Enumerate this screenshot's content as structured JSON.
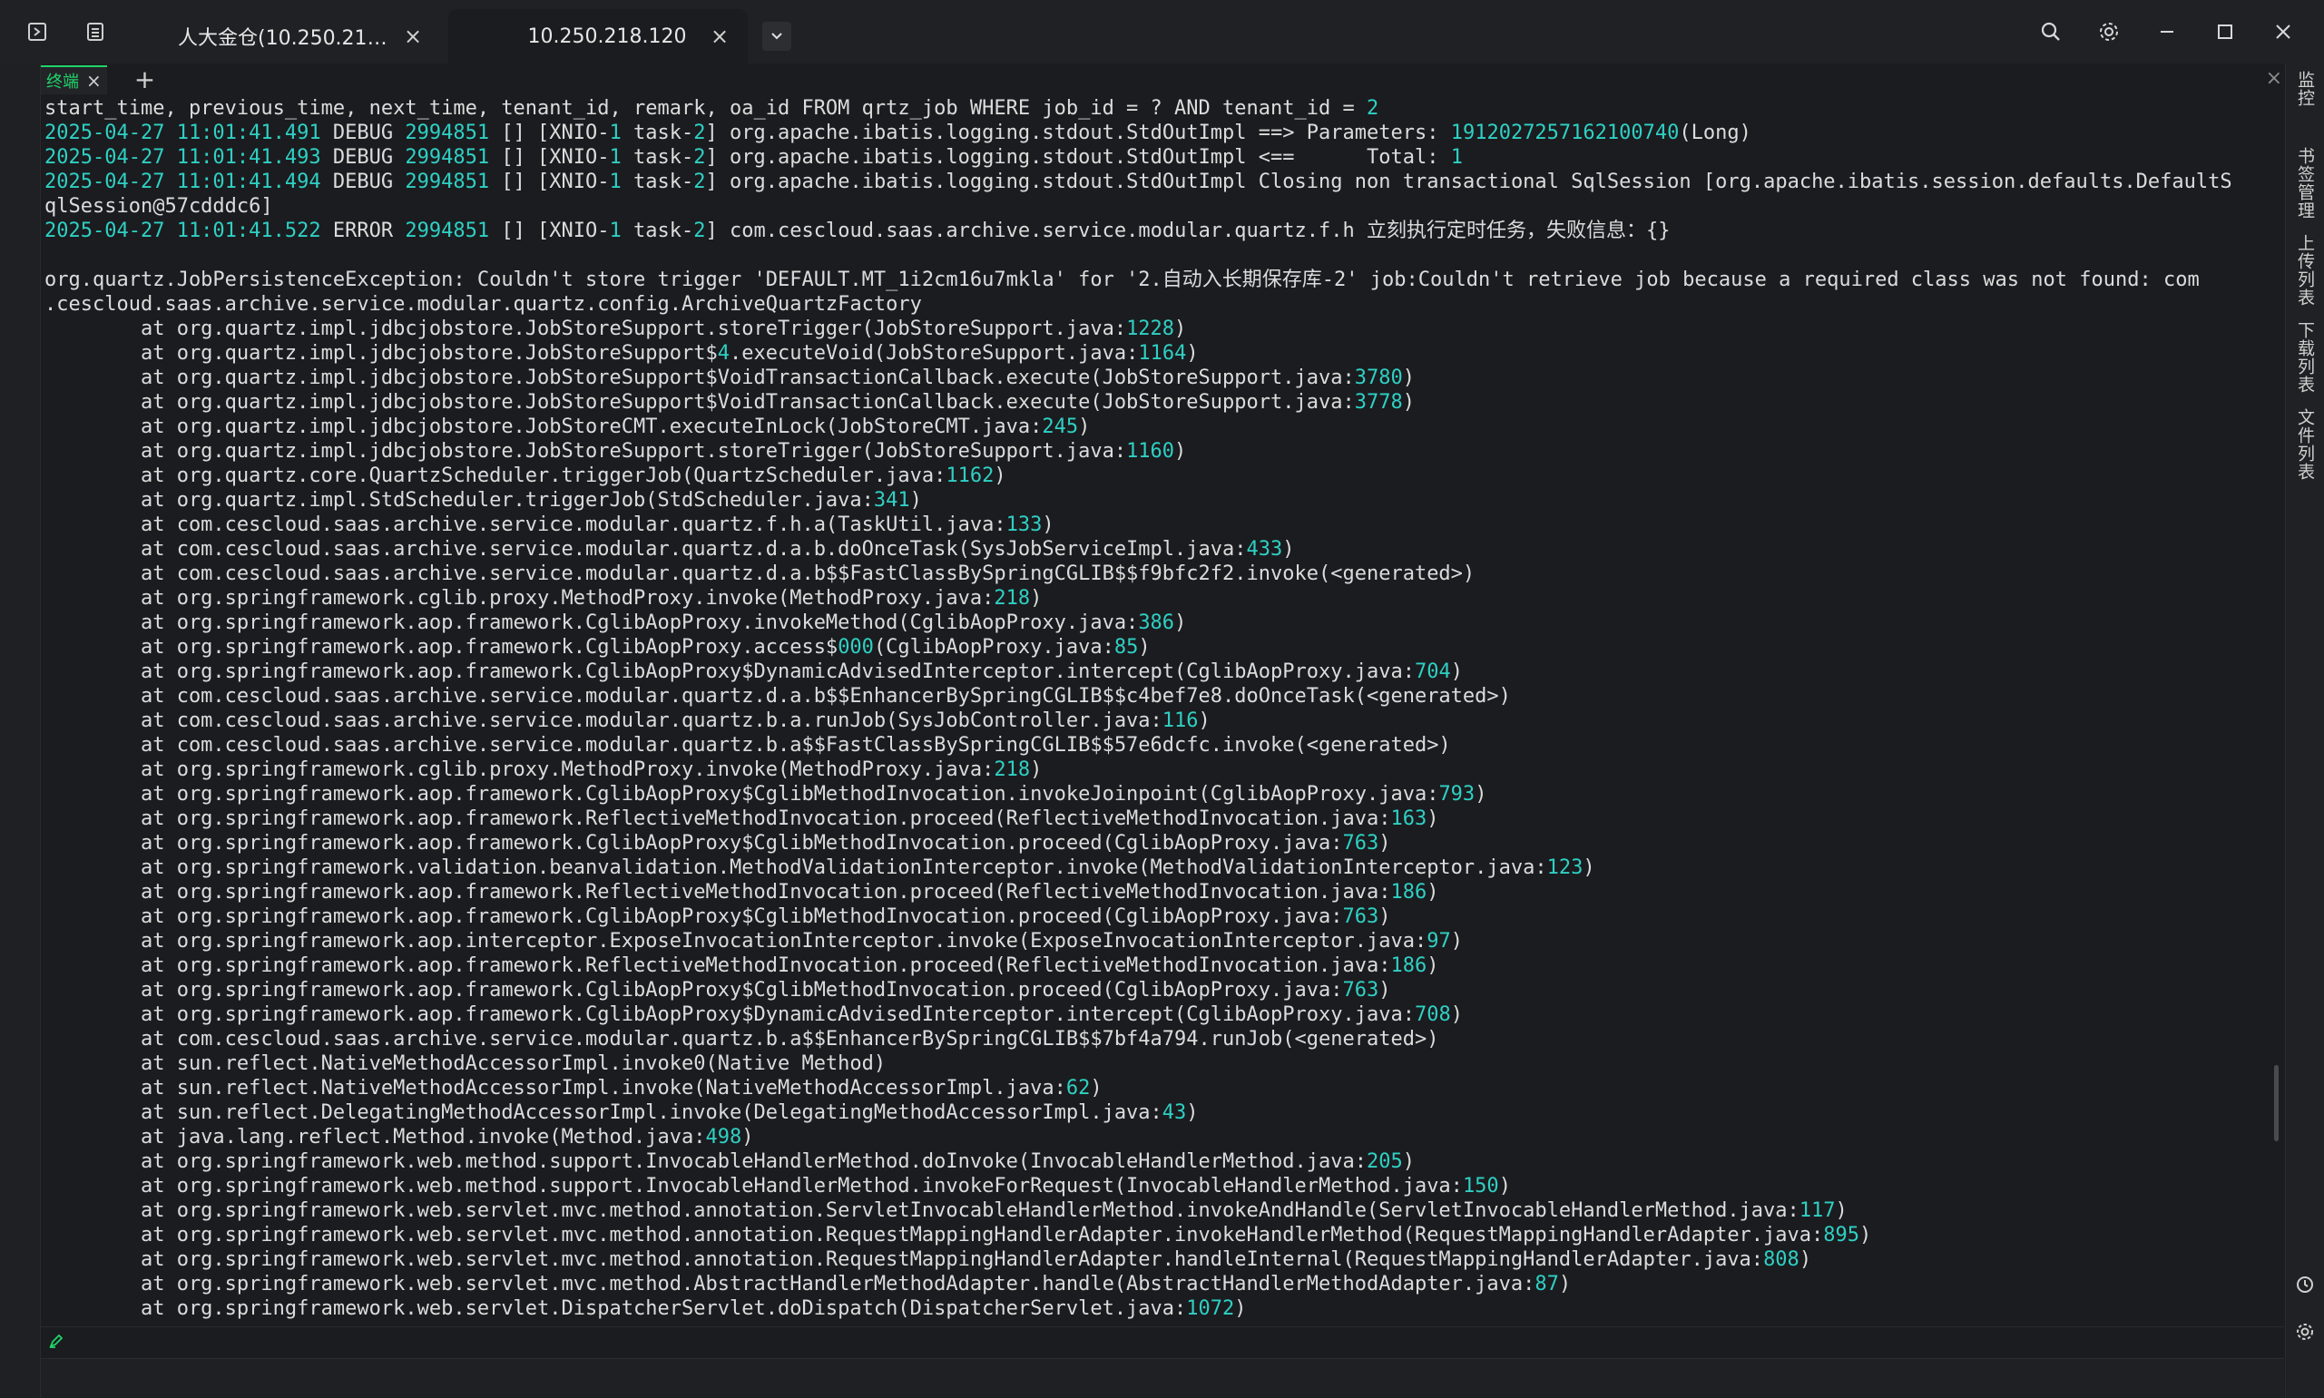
{
  "titlebar": {
    "tabs": [
      {
        "label": "人大金仓(10.250.218.2...",
        "active": false
      },
      {
        "label": "10.250.218.120",
        "active": true
      }
    ],
    "left_icons": [
      "sidebar-toggle-icon",
      "session-list-icon"
    ],
    "right_icons": [
      "search-icon",
      "settings-icon",
      "minimize-icon",
      "maximize-icon",
      "close-icon"
    ]
  },
  "subtabs": {
    "items": [
      {
        "label": "终端"
      }
    ],
    "add_label": "+"
  },
  "right_panel": {
    "tabs": [
      {
        "label": "监控"
      },
      {
        "label": "书签管理"
      },
      {
        "label": "上传列表"
      },
      {
        "label": "下载列表"
      },
      {
        "label": "文件列表"
      }
    ],
    "bottom_icons": [
      "history-icon",
      "gear-icon"
    ]
  },
  "colors": {
    "accent": "#20d46a",
    "log_highlight": "#2fd0c4",
    "background": "#1b1c1f"
  },
  "terminal": {
    "lines": [
      [
        {
          "t": "start_time, previous_time, next_time, tenant_id, remark, oa_id FROM qrtz_job WHERE job_id = ? AND tenant_id = ",
          "c": "w"
        },
        {
          "t": "2",
          "c": "c"
        }
      ],
      [
        {
          "t": "2025-04-27 11:01:41.491",
          "c": "c"
        },
        {
          "t": " DEBUG ",
          "c": "w"
        },
        {
          "t": "2994851",
          "c": "c"
        },
        {
          "t": " [] [XNIO-",
          "c": "w"
        },
        {
          "t": "1",
          "c": "c"
        },
        {
          "t": " task-",
          "c": "w"
        },
        {
          "t": "2",
          "c": "c"
        },
        {
          "t": "] org.apache.ibatis.logging.stdout.StdOutImpl ==> Parameters: ",
          "c": "w"
        },
        {
          "t": "1912027257162100740",
          "c": "c"
        },
        {
          "t": "(Long)",
          "c": "w"
        }
      ],
      [
        {
          "t": "2025-04-27 11:01:41.493",
          "c": "c"
        },
        {
          "t": " DEBUG ",
          "c": "w"
        },
        {
          "t": "2994851",
          "c": "c"
        },
        {
          "t": " [] [XNIO-",
          "c": "w"
        },
        {
          "t": "1",
          "c": "c"
        },
        {
          "t": " task-",
          "c": "w"
        },
        {
          "t": "2",
          "c": "c"
        },
        {
          "t": "] org.apache.ibatis.logging.stdout.StdOutImpl <==      Total: ",
          "c": "w"
        },
        {
          "t": "1",
          "c": "c"
        }
      ],
      [
        {
          "t": "2025-04-27 11:01:41.494",
          "c": "c"
        },
        {
          "t": " DEBUG ",
          "c": "w"
        },
        {
          "t": "2994851",
          "c": "c"
        },
        {
          "t": " [] [XNIO-",
          "c": "w"
        },
        {
          "t": "1",
          "c": "c"
        },
        {
          "t": " task-",
          "c": "w"
        },
        {
          "t": "2",
          "c": "c"
        },
        {
          "t": "] org.apache.ibatis.logging.stdout.StdOutImpl Closing non transactional SqlSession [org.apache.ibatis.session.defaults.DefaultS",
          "c": "w"
        }
      ],
      [
        {
          "t": "qlSession@57cdddc6]",
          "c": "w"
        }
      ],
      [
        {
          "t": "2025-04-27 11:01:41.522",
          "c": "c"
        },
        {
          "t": " ERROR ",
          "c": "w"
        },
        {
          "t": "2994851",
          "c": "c"
        },
        {
          "t": " [] [XNIO-",
          "c": "w"
        },
        {
          "t": "1",
          "c": "c"
        },
        {
          "t": " task-",
          "c": "w"
        },
        {
          "t": "2",
          "c": "c"
        },
        {
          "t": "] com.cescloud.saas.archive.service.modular.quartz.f.h 立刻执行定时任务，失败信息：{}",
          "c": "w"
        }
      ],
      [
        {
          "t": " ",
          "c": "w"
        }
      ],
      [
        {
          "t": "org.quartz.JobPersistenceException: Couldn't store trigger 'DEFAULT.MT_1i2cm16u7mkla' for '2.自动入长期保存库-2' job:Couldn't retrieve job because a required class was not found: com",
          "c": "w"
        }
      ],
      [
        {
          "t": ".cescloud.saas.archive.service.modular.quartz.config.ArchiveQuartzFactory",
          "c": "w"
        }
      ],
      [
        {
          "t": "        at org.quartz.impl.jdbcjobstore.JobStoreSupport.storeTrigger(JobStoreSupport.java:",
          "c": "w"
        },
        {
          "t": "1228",
          "c": "c"
        },
        {
          "t": ")",
          "c": "w"
        }
      ],
      [
        {
          "t": "        at org.quartz.impl.jdbcjobstore.JobStoreSupport$",
          "c": "w"
        },
        {
          "t": "4",
          "c": "c"
        },
        {
          "t": ".executeVoid(JobStoreSupport.java:",
          "c": "w"
        },
        {
          "t": "1164",
          "c": "c"
        },
        {
          "t": ")",
          "c": "w"
        }
      ],
      [
        {
          "t": "        at org.quartz.impl.jdbcjobstore.JobStoreSupport$VoidTransactionCallback.execute(JobStoreSupport.java:",
          "c": "w"
        },
        {
          "t": "3780",
          "c": "c"
        },
        {
          "t": ")",
          "c": "w"
        }
      ],
      [
        {
          "t": "        at org.quartz.impl.jdbcjobstore.JobStoreSupport$VoidTransactionCallback.execute(JobStoreSupport.java:",
          "c": "w"
        },
        {
          "t": "3778",
          "c": "c"
        },
        {
          "t": ")",
          "c": "w"
        }
      ],
      [
        {
          "t": "        at org.quartz.impl.jdbcjobstore.JobStoreCMT.executeInLock(JobStoreCMT.java:",
          "c": "w"
        },
        {
          "t": "245",
          "c": "c"
        },
        {
          "t": ")",
          "c": "w"
        }
      ],
      [
        {
          "t": "        at org.quartz.impl.jdbcjobstore.JobStoreSupport.storeTrigger(JobStoreSupport.java:",
          "c": "w"
        },
        {
          "t": "1160",
          "c": "c"
        },
        {
          "t": ")",
          "c": "w"
        }
      ],
      [
        {
          "t": "        at org.quartz.core.QuartzScheduler.triggerJob(QuartzScheduler.java:",
          "c": "w"
        },
        {
          "t": "1162",
          "c": "c"
        },
        {
          "t": ")",
          "c": "w"
        }
      ],
      [
        {
          "t": "        at org.quartz.impl.StdScheduler.triggerJob(StdScheduler.java:",
          "c": "w"
        },
        {
          "t": "341",
          "c": "c"
        },
        {
          "t": ")",
          "c": "w"
        }
      ],
      [
        {
          "t": "        at com.cescloud.saas.archive.service.modular.quartz.f.h.a(TaskUtil.java:",
          "c": "w"
        },
        {
          "t": "133",
          "c": "c"
        },
        {
          "t": ")",
          "c": "w"
        }
      ],
      [
        {
          "t": "        at com.cescloud.saas.archive.service.modular.quartz.d.a.b.doOnceTask(SysJobServiceImpl.java:",
          "c": "w"
        },
        {
          "t": "433",
          "c": "c"
        },
        {
          "t": ")",
          "c": "w"
        }
      ],
      [
        {
          "t": "        at com.cescloud.saas.archive.service.modular.quartz.d.a.b$$FastClassBySpringCGLIB$$f9bfc2f2.invoke(<generated>)",
          "c": "w"
        }
      ],
      [
        {
          "t": "        at org.springframework.cglib.proxy.MethodProxy.invoke(MethodProxy.java:",
          "c": "w"
        },
        {
          "t": "218",
          "c": "c"
        },
        {
          "t": ")",
          "c": "w"
        }
      ],
      [
        {
          "t": "        at org.springframework.aop.framework.CglibAopProxy.invokeMethod(CglibAopProxy.java:",
          "c": "w"
        },
        {
          "t": "386",
          "c": "c"
        },
        {
          "t": ")",
          "c": "w"
        }
      ],
      [
        {
          "t": "        at org.springframework.aop.framework.CglibAopProxy.access$",
          "c": "w"
        },
        {
          "t": "000",
          "c": "c"
        },
        {
          "t": "(CglibAopProxy.java:",
          "c": "w"
        },
        {
          "t": "85",
          "c": "c"
        },
        {
          "t": ")",
          "c": "w"
        }
      ],
      [
        {
          "t": "        at org.springframework.aop.framework.CglibAopProxy$DynamicAdvisedInterceptor.intercept(CglibAopProxy.java:",
          "c": "w"
        },
        {
          "t": "704",
          "c": "c"
        },
        {
          "t": ")",
          "c": "w"
        }
      ],
      [
        {
          "t": "        at com.cescloud.saas.archive.service.modular.quartz.d.a.b$$EnhancerBySpringCGLIB$$c4bef7e8.doOnceTask(<generated>)",
          "c": "w"
        }
      ],
      [
        {
          "t": "        at com.cescloud.saas.archive.service.modular.quartz.b.a.runJob(SysJobController.java:",
          "c": "w"
        },
        {
          "t": "116",
          "c": "c"
        },
        {
          "t": ")",
          "c": "w"
        }
      ],
      [
        {
          "t": "        at com.cescloud.saas.archive.service.modular.quartz.b.a$$FastClassBySpringCGLIB$$57e6dcfc.invoke(<generated>)",
          "c": "w"
        }
      ],
      [
        {
          "t": "        at org.springframework.cglib.proxy.MethodProxy.invoke(MethodProxy.java:",
          "c": "w"
        },
        {
          "t": "218",
          "c": "c"
        },
        {
          "t": ")",
          "c": "w"
        }
      ],
      [
        {
          "t": "        at org.springframework.aop.framework.CglibAopProxy$CglibMethodInvocation.invokeJoinpoint(CglibAopProxy.java:",
          "c": "w"
        },
        {
          "t": "793",
          "c": "c"
        },
        {
          "t": ")",
          "c": "w"
        }
      ],
      [
        {
          "t": "        at org.springframework.aop.framework.ReflectiveMethodInvocation.proceed(ReflectiveMethodInvocation.java:",
          "c": "w"
        },
        {
          "t": "163",
          "c": "c"
        },
        {
          "t": ")",
          "c": "w"
        }
      ],
      [
        {
          "t": "        at org.springframework.aop.framework.CglibAopProxy$CglibMethodInvocation.proceed(CglibAopProxy.java:",
          "c": "w"
        },
        {
          "t": "763",
          "c": "c"
        },
        {
          "t": ")",
          "c": "w"
        }
      ],
      [
        {
          "t": "        at org.springframework.validation.beanvalidation.MethodValidationInterceptor.invoke(MethodValidationInterceptor.java:",
          "c": "w"
        },
        {
          "t": "123",
          "c": "c"
        },
        {
          "t": ")",
          "c": "w"
        }
      ],
      [
        {
          "t": "        at org.springframework.aop.framework.ReflectiveMethodInvocation.proceed(ReflectiveMethodInvocation.java:",
          "c": "w"
        },
        {
          "t": "186",
          "c": "c"
        },
        {
          "t": ")",
          "c": "w"
        }
      ],
      [
        {
          "t": "        at org.springframework.aop.framework.CglibAopProxy$CglibMethodInvocation.proceed(CglibAopProxy.java:",
          "c": "w"
        },
        {
          "t": "763",
          "c": "c"
        },
        {
          "t": ")",
          "c": "w"
        }
      ],
      [
        {
          "t": "        at org.springframework.aop.interceptor.ExposeInvocationInterceptor.invoke(ExposeInvocationInterceptor.java:",
          "c": "w"
        },
        {
          "t": "97",
          "c": "c"
        },
        {
          "t": ")",
          "c": "w"
        }
      ],
      [
        {
          "t": "        at org.springframework.aop.framework.ReflectiveMethodInvocation.proceed(ReflectiveMethodInvocation.java:",
          "c": "w"
        },
        {
          "t": "186",
          "c": "c"
        },
        {
          "t": ")",
          "c": "w"
        }
      ],
      [
        {
          "t": "        at org.springframework.aop.framework.CglibAopProxy$CglibMethodInvocation.proceed(CglibAopProxy.java:",
          "c": "w"
        },
        {
          "t": "763",
          "c": "c"
        },
        {
          "t": ")",
          "c": "w"
        }
      ],
      [
        {
          "t": "        at org.springframework.aop.framework.CglibAopProxy$DynamicAdvisedInterceptor.intercept(CglibAopProxy.java:",
          "c": "w"
        },
        {
          "t": "708",
          "c": "c"
        },
        {
          "t": ")",
          "c": "w"
        }
      ],
      [
        {
          "t": "        at com.cescloud.saas.archive.service.modular.quartz.b.a$$EnhancerBySpringCGLIB$$7bf4a794.runJob(<generated>)",
          "c": "w"
        }
      ],
      [
        {
          "t": "        at sun.reflect.NativeMethodAccessorImpl.invoke0(Native Method)",
          "c": "w"
        }
      ],
      [
        {
          "t": "        at sun.reflect.NativeMethodAccessorImpl.invoke(NativeMethodAccessorImpl.java:",
          "c": "w"
        },
        {
          "t": "62",
          "c": "c"
        },
        {
          "t": ")",
          "c": "w"
        }
      ],
      [
        {
          "t": "        at sun.reflect.DelegatingMethodAccessorImpl.invoke(DelegatingMethodAccessorImpl.java:",
          "c": "w"
        },
        {
          "t": "43",
          "c": "c"
        },
        {
          "t": ")",
          "c": "w"
        }
      ],
      [
        {
          "t": "        at java.lang.reflect.Method.invoke(Method.java:",
          "c": "w"
        },
        {
          "t": "498",
          "c": "c"
        },
        {
          "t": ")",
          "c": "w"
        }
      ],
      [
        {
          "t": "        at org.springframework.web.method.support.InvocableHandlerMethod.doInvoke(InvocableHandlerMethod.java:",
          "c": "w"
        },
        {
          "t": "205",
          "c": "c"
        },
        {
          "t": ")",
          "c": "w"
        }
      ],
      [
        {
          "t": "        at org.springframework.web.method.support.InvocableHandlerMethod.invokeForRequest(InvocableHandlerMethod.java:",
          "c": "w"
        },
        {
          "t": "150",
          "c": "c"
        },
        {
          "t": ")",
          "c": "w"
        }
      ],
      [
        {
          "t": "        at org.springframework.web.servlet.mvc.method.annotation.ServletInvocableHandlerMethod.invokeAndHandle(ServletInvocableHandlerMethod.java:",
          "c": "w"
        },
        {
          "t": "117",
          "c": "c"
        },
        {
          "t": ")",
          "c": "w"
        }
      ],
      [
        {
          "t": "        at org.springframework.web.servlet.mvc.method.annotation.RequestMappingHandlerAdapter.invokeHandlerMethod(RequestMappingHandlerAdapter.java:",
          "c": "w"
        },
        {
          "t": "895",
          "c": "c"
        },
        {
          "t": ")",
          "c": "w"
        }
      ],
      [
        {
          "t": "        at org.springframework.web.servlet.mvc.method.annotation.RequestMappingHandlerAdapter.handleInternal(RequestMappingHandlerAdapter.java:",
          "c": "w"
        },
        {
          "t": "808",
          "c": "c"
        },
        {
          "t": ")",
          "c": "w"
        }
      ],
      [
        {
          "t": "        at org.springframework.web.servlet.mvc.method.AbstractHandlerMethodAdapter.handle(AbstractHandlerMethodAdapter.java:",
          "c": "w"
        },
        {
          "t": "87",
          "c": "c"
        },
        {
          "t": ")",
          "c": "w"
        }
      ],
      [
        {
          "t": "        at org.springframework.web.servlet.DispatcherServlet.doDispatch(DispatcherServlet.java:",
          "c": "w"
        },
        {
          "t": "1072",
          "c": "c"
        },
        {
          "t": ")",
          "c": "w"
        }
      ]
    ]
  }
}
